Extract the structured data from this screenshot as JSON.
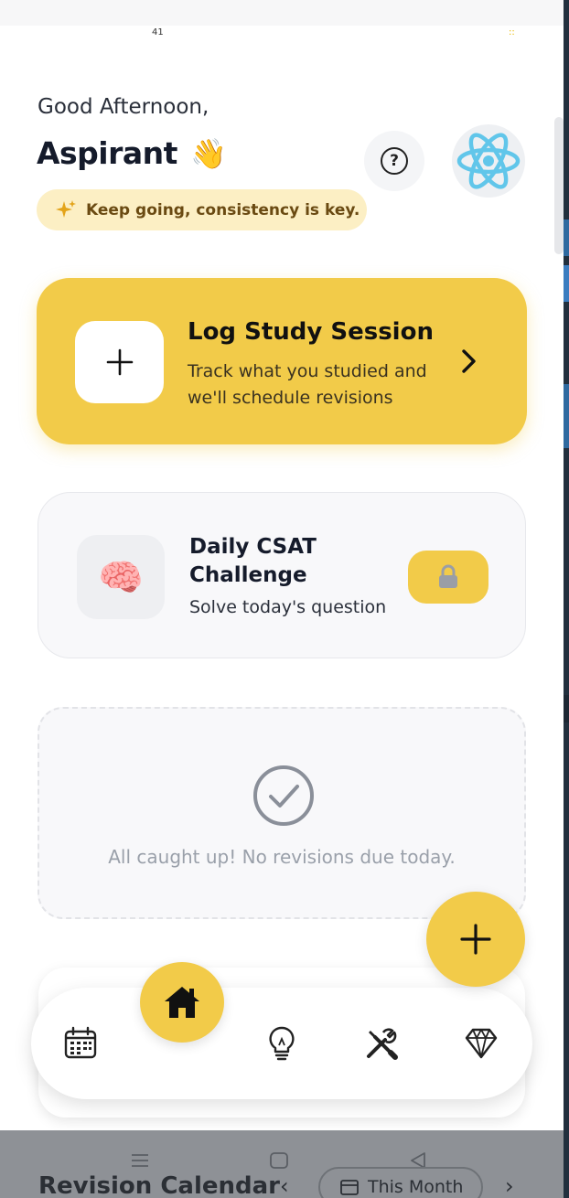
{
  "status_bar": {
    "left_text": "41",
    "right_text": "::"
  },
  "header": {
    "greeting": "Good Afternoon,",
    "name": "Aspirant",
    "name_emoji": "👋",
    "motivation": "Keep going, consistency is key.",
    "help_icon": "help-circle-icon",
    "avatar_icon": "react-atom-icon"
  },
  "log_session": {
    "title": "Log Study Session",
    "subtitle": "Track what you studied and we'll schedule revisions",
    "action_icon": "plus-icon"
  },
  "csat": {
    "title": "Daily CSAT Challenge",
    "subtitle": "Solve today's question",
    "icon": "brain-icon",
    "lock_icon": "lock-icon"
  },
  "revisions": {
    "empty_message": "All caught up! No revisions due today."
  },
  "bottom_nav": {
    "items": [
      {
        "icon": "calendar-icon"
      },
      {
        "icon": "home-icon",
        "active": true
      },
      {
        "icon": "lightbulb-icon"
      },
      {
        "icon": "tools-icon"
      },
      {
        "icon": "diamond-icon"
      }
    ]
  },
  "behind_content": {
    "section_title": "Revision Calendar",
    "range_label": "This Month"
  },
  "colors": {
    "accent": "#F2CB49",
    "pill_bg": "#FCEFC4",
    "text_dark": "#151B2B",
    "muted": "#9AA0AA"
  }
}
